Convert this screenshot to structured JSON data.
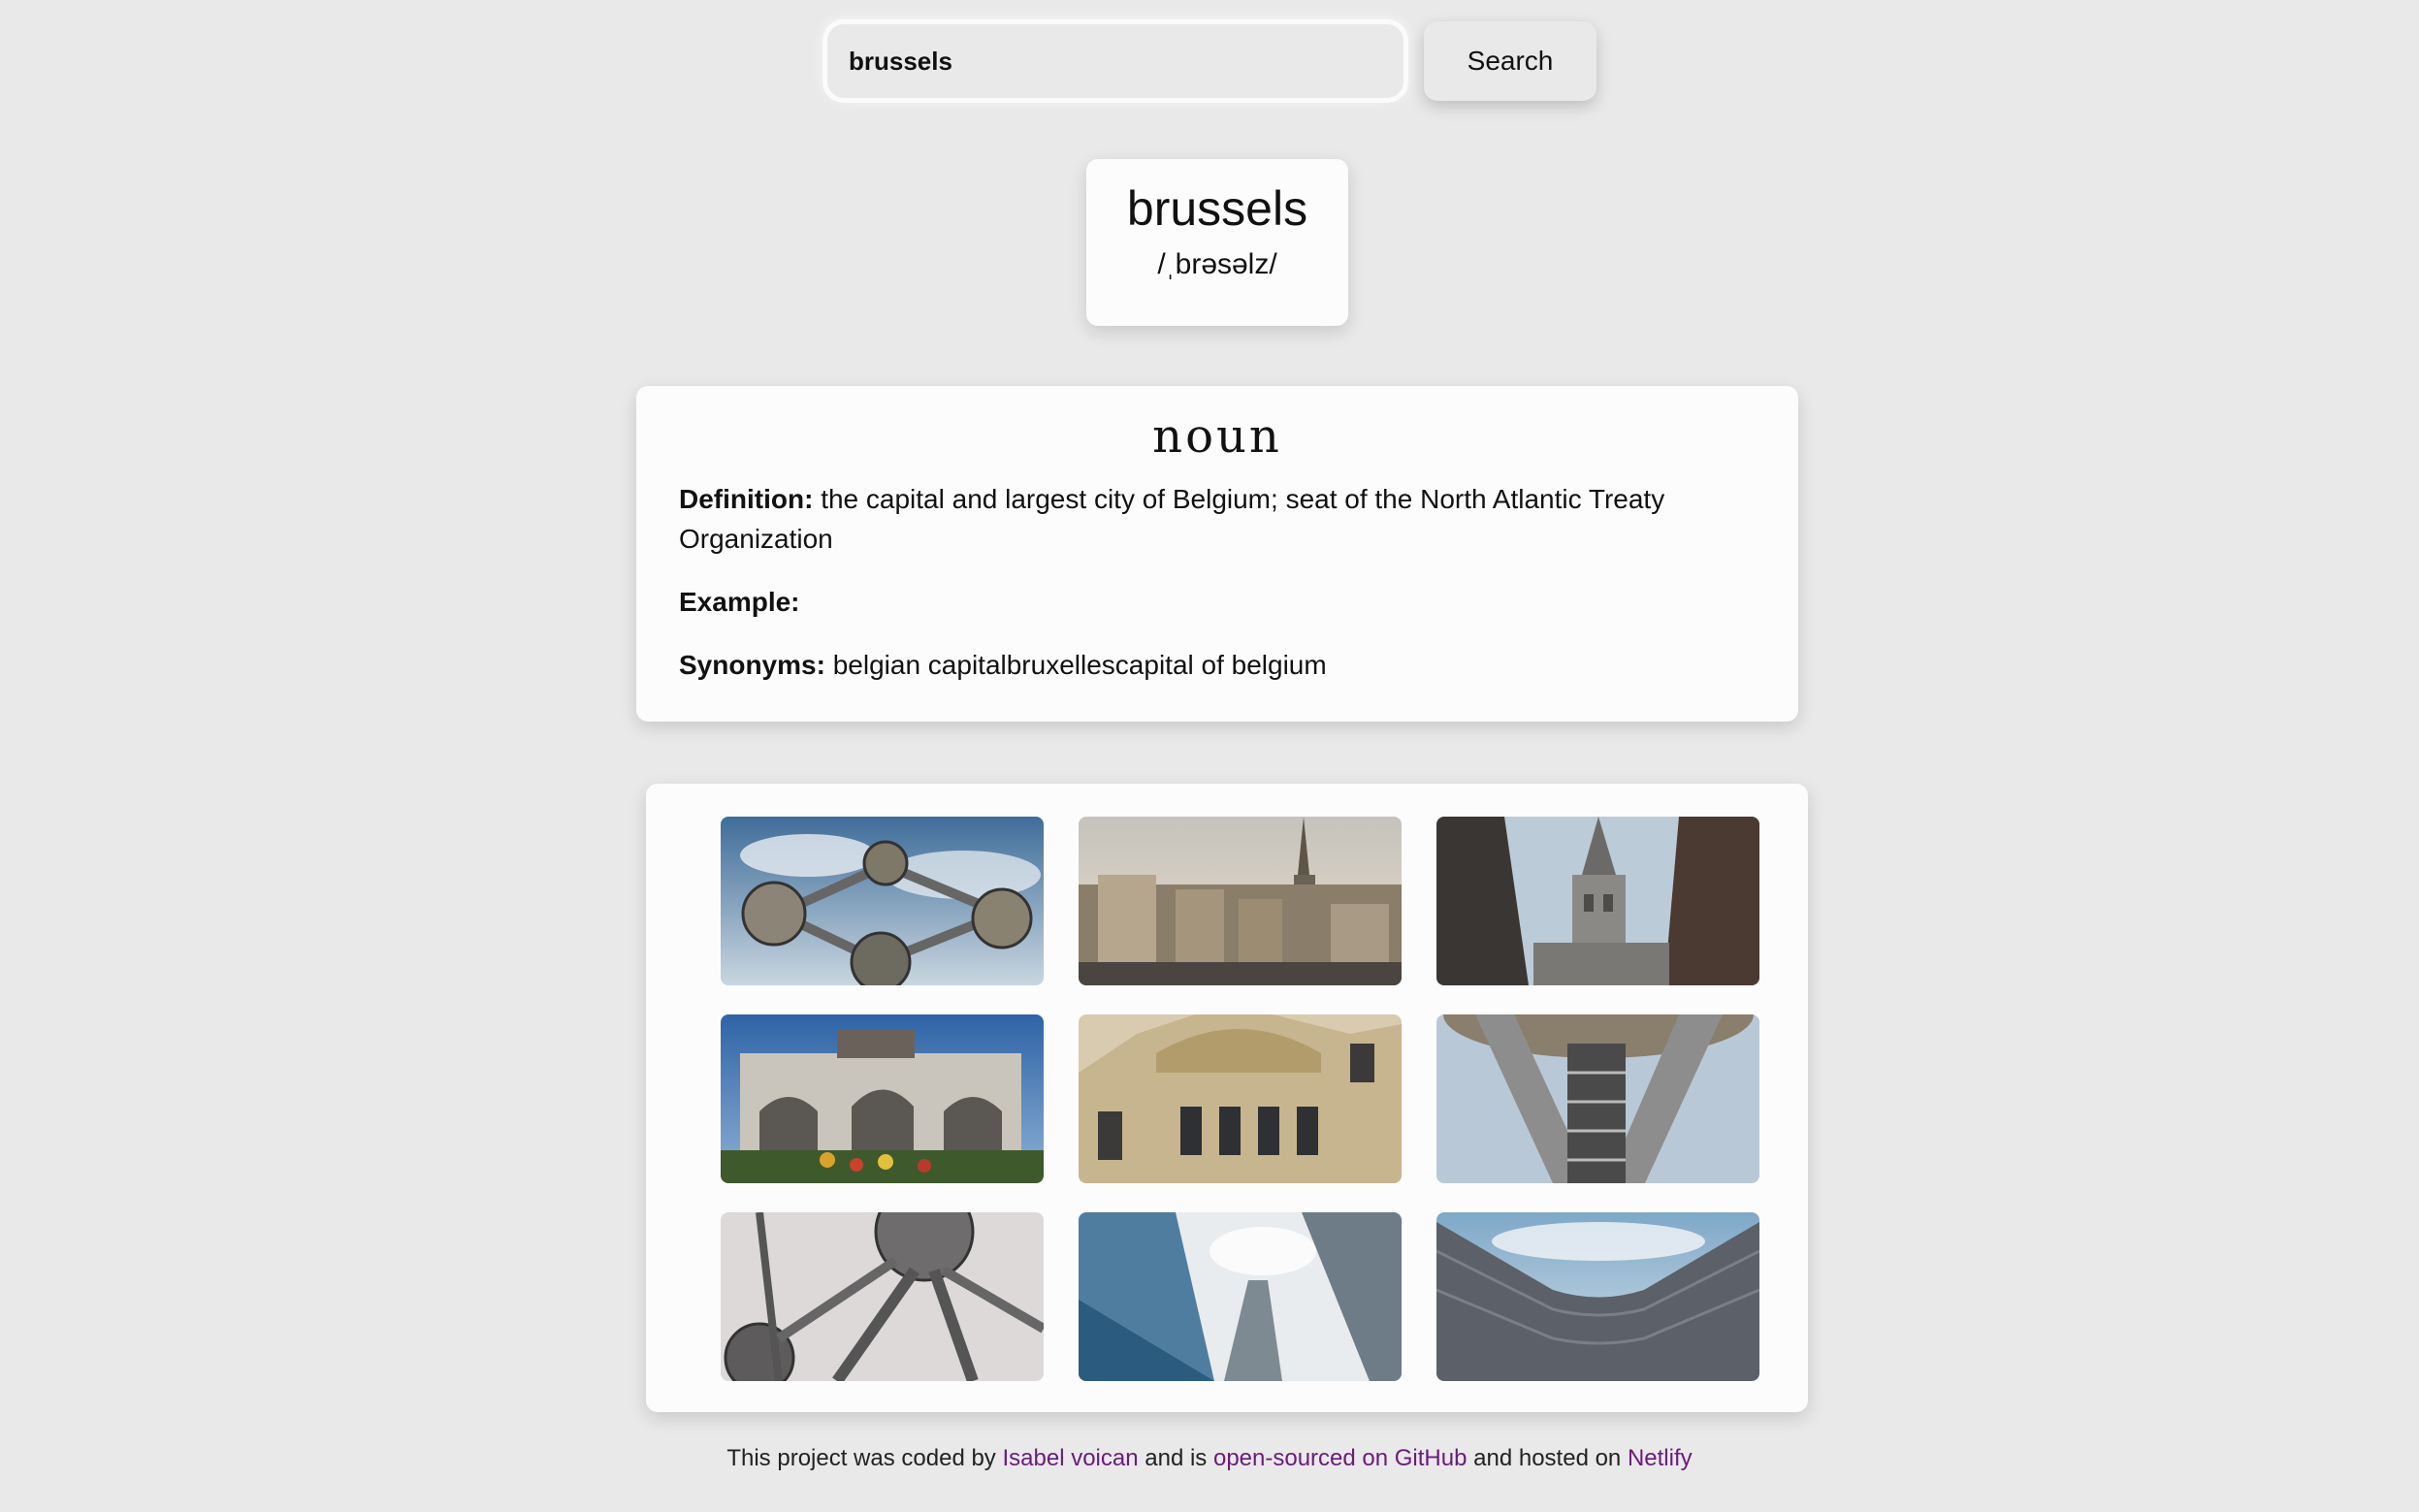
{
  "search": {
    "value": "brussels",
    "button_label": "Search"
  },
  "word": {
    "title": "brussels",
    "phonetic": "/ˌbrəsəlz/"
  },
  "meaning": {
    "part_of_speech": "noun",
    "definition_label": "Definition:",
    "definition": "the capital and largest city of Belgium; seat of the North Atlantic Treaty Organization",
    "example_label": "Example:",
    "example": "",
    "synonyms_label": "Synonyms:",
    "synonyms": "belgian capitalbruxellescapital of belgium"
  },
  "photos": [
    {
      "subject": "atomium-sky"
    },
    {
      "subject": "grand-place-skyline"
    },
    {
      "subject": "town-hall-tower"
    },
    {
      "subject": "cinquantenaire-arch"
    },
    {
      "subject": "guild-house-facade"
    },
    {
      "subject": "atomium-stairs"
    },
    {
      "subject": "atomium-below"
    },
    {
      "subject": "glass-towers"
    },
    {
      "subject": "eu-building"
    }
  ],
  "footer": {
    "text_1": "This project was coded by",
    "author_link": "Isabel voican",
    "text_2": "and is",
    "github_link": "open-sourced on GitHub",
    "text_3": "and hosted on",
    "host_link": "Netlify"
  },
  "colors": {
    "background": "#e9e9e9",
    "card": "#fcfcfc",
    "link": "#6b1a7e"
  }
}
